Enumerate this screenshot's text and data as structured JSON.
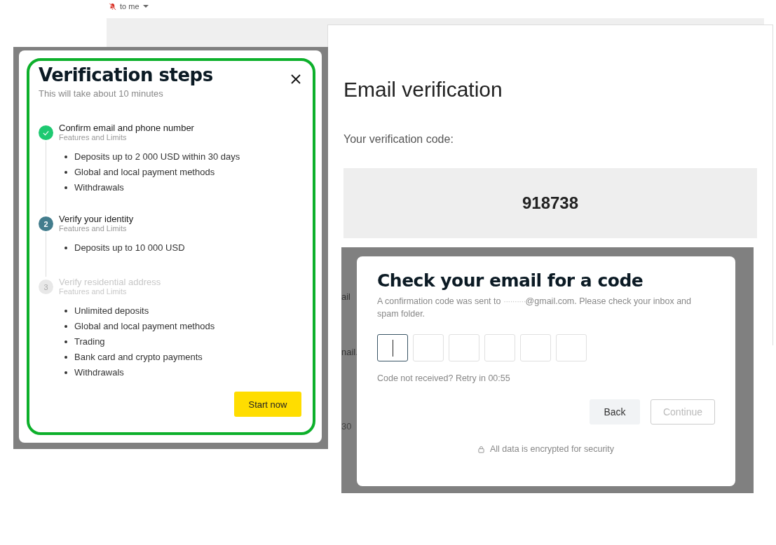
{
  "email_header": {
    "recipient": "to me"
  },
  "email": {
    "title": "Email verification",
    "code_label": "Your verification code:",
    "code": "918738"
  },
  "background_fragments": [
    {
      "text": "ail"
    },
    {
      "text": "nail."
    },
    {
      "text": "30"
    }
  ],
  "verification_modal": {
    "title": "Verification steps",
    "subtitle": "This will take about 10 minutes",
    "steps": [
      {
        "kind": "done",
        "title": "Confirm email and phone number",
        "caption": "Features and Limits",
        "features": [
          "Deposits up to 2 000 USD within 30 days",
          "Global and local payment methods",
          "Withdrawals"
        ]
      },
      {
        "kind": "current",
        "number": "2",
        "title": "Verify your identity",
        "caption": "Features and Limits",
        "features": [
          "Deposits up to 10 000 USD"
        ]
      },
      {
        "kind": "pending",
        "number": "3",
        "title": "Verify residential address",
        "caption": "Features and Limits",
        "features": [
          "Unlimited deposits",
          "Global and local payment methods",
          "Trading",
          "Bank card and crypto payments",
          "Withdrawals"
        ]
      }
    ],
    "button": "Start now"
  },
  "code_modal": {
    "title": "Check your email for a code",
    "message_start": "A confirmation code was sent to ",
    "masked_address": "··········",
    "message_end": "@gmail.com. Please check your inbox and spam folder.",
    "digits": [
      {
        "focused": true
      },
      {
        "focused": false
      },
      {
        "focused": false
      },
      {
        "focused": false
      },
      {
        "focused": false
      },
      {
        "focused": false
      }
    ],
    "retry": "Code not received? Retry in 00:55",
    "buttons": [
      {
        "label": "Back",
        "disabled": false
      },
      {
        "label": "Continue",
        "disabled": true
      }
    ],
    "security_note": "All data is encrypted for security"
  }
}
